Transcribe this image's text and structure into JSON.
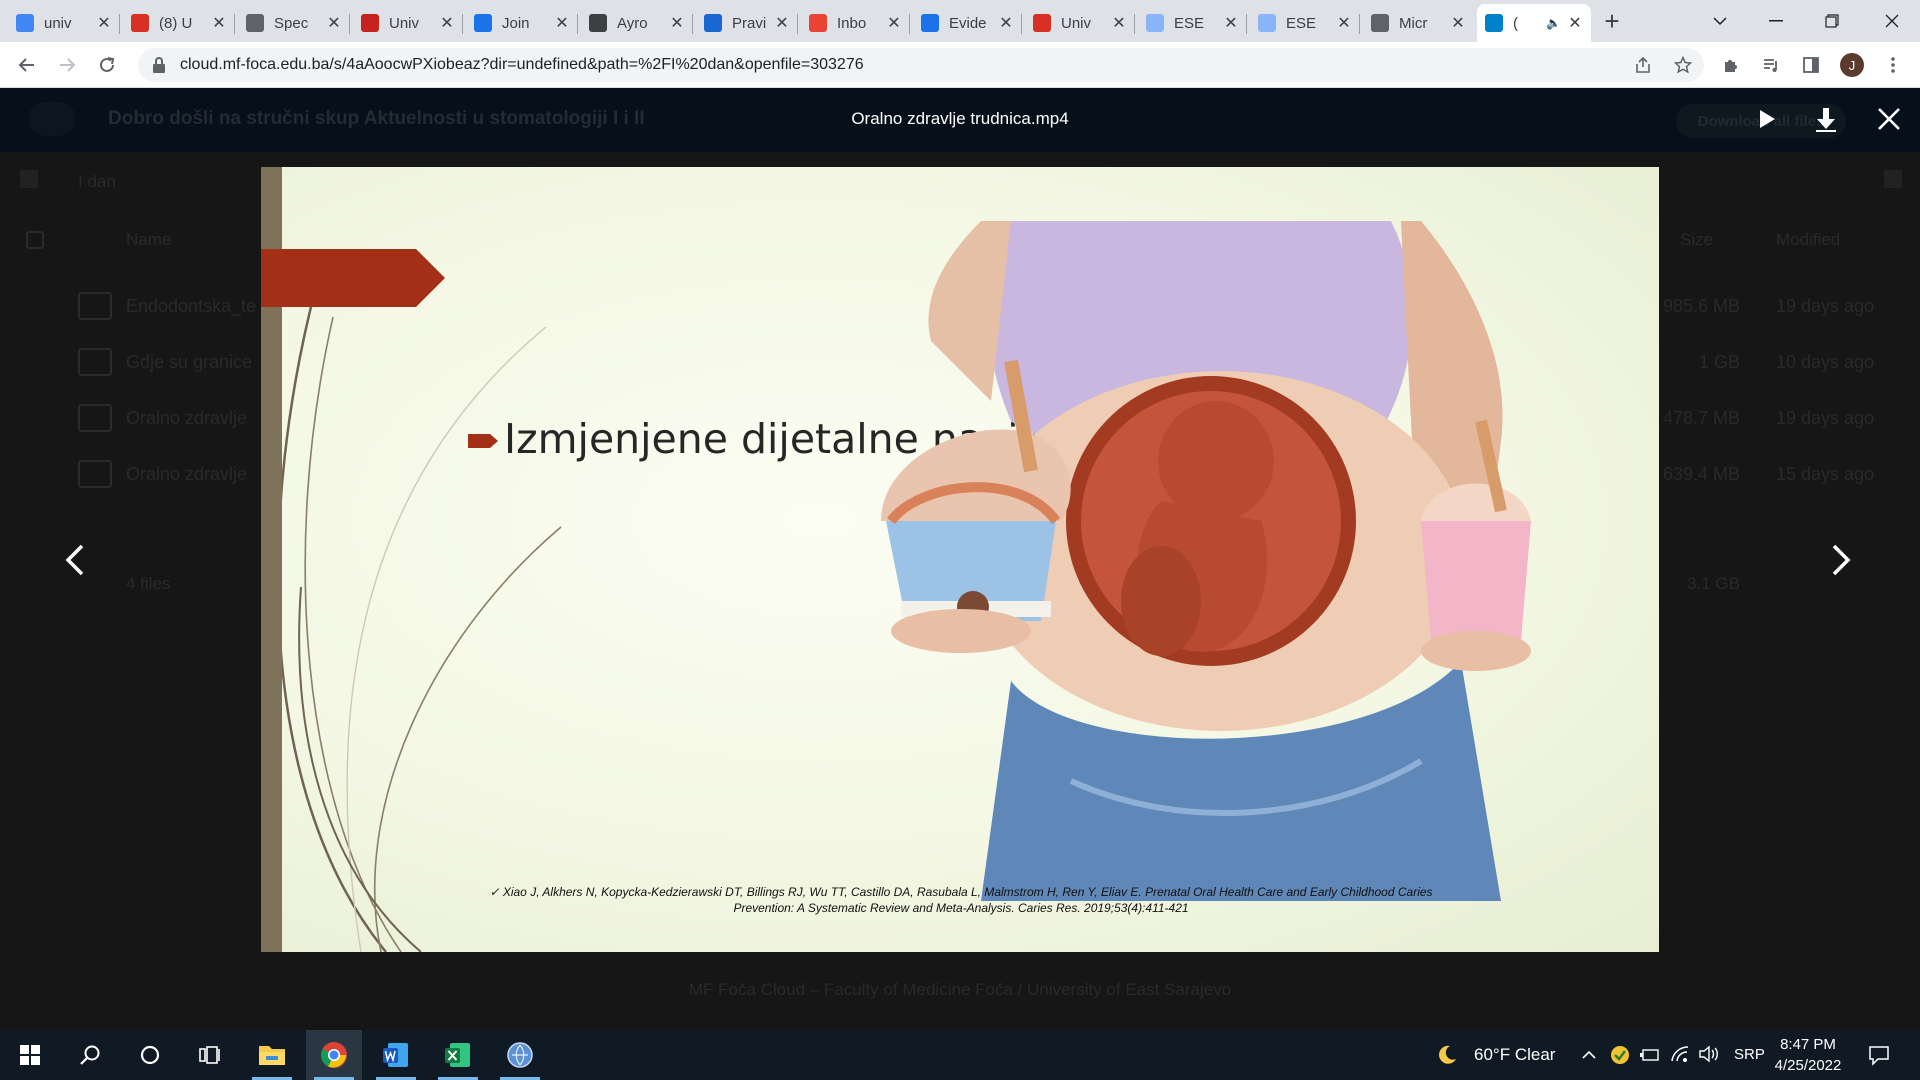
{
  "browser": {
    "tabs": [
      {
        "title": "univ",
        "favicon": "google-icon",
        "color": "#4285f4"
      },
      {
        "title": "(8) U",
        "favicon": "gmail-like-icon",
        "color": "#d93025"
      },
      {
        "title": "Spec",
        "favicon": "globe-icon",
        "color": "#5f6368"
      },
      {
        "title": "Univ",
        "favicon": "shield-crest-icon",
        "color": "#c5221f"
      },
      {
        "title": "Join",
        "favicon": "edge-icon",
        "color": "#1a73e8"
      },
      {
        "title": "Ayro",
        "favicon": "wordpress-icon",
        "color": "#3c4043"
      },
      {
        "title": "Pravi",
        "favicon": "building-icon",
        "color": "#1967d2"
      },
      {
        "title": "Inbo",
        "favicon": "gmail-icon",
        "color": "#ea4335"
      },
      {
        "title": "Evide",
        "favicon": "diamond-icon",
        "color": "#1a73e8"
      },
      {
        "title": "Univ",
        "favicon": "mail-red-icon",
        "color": "#d93025"
      },
      {
        "title": "ESE",
        "favicon": "flag-icon",
        "color": "#8ab4f8"
      },
      {
        "title": "ESE",
        "favicon": "flag-icon",
        "color": "#8ab4f8"
      },
      {
        "title": "Micr",
        "favicon": "globe-icon",
        "color": "#5f6368"
      },
      {
        "title": "(",
        "favicon": "nextcloud-icon",
        "color": "#0082c9"
      }
    ],
    "url": "cloud.mf-foca.edu.ba/s/4aAoocwPXiobeaz?dir=undefined&path=%2FI%20dan&openfile=303276",
    "profile_initial": "J"
  },
  "nextcloud": {
    "share_title": "Dobro došli na stručni skup Aktuelnosti u stomatologiji I i II",
    "download_all": "Download all files",
    "breadcrumb": "I dan",
    "columns": {
      "name": "Name",
      "size": "Size",
      "modified": "Modified"
    },
    "files": [
      {
        "name": "Endodontska_te",
        "size": "985.6 MB",
        "modified": "19 days ago"
      },
      {
        "name": "Gdje su granice",
        "size": "1 GB",
        "modified": "10 days ago"
      },
      {
        "name": "Oralno zdravlje",
        "size": "478.7 MB",
        "modified": "19 days ago"
      },
      {
        "name": "Oralno zdravlje",
        "size": "639.4 MB",
        "modified": "15 days ago"
      }
    ],
    "files_count": "4 files",
    "total_size": "3.1 GB",
    "footer": "MF Foča Cloud – Faculty of Medicine Foča / University of East Sarajevo"
  },
  "viewer": {
    "file_title": "Oralno zdravlje trudnica.mp4",
    "slide": {
      "bullet": "Izmjenjene dijetalne navike",
      "citation_line1": "✓  Xiao J, Alkhers N, Kopycka-Kedzierawski DT, Billings RJ, Wu TT, Castillo DA, Rasubala L, Malmstrom H, Ren Y, Eliav E. Prenatal Oral Health Care and Early Childhood Caries",
      "citation_line2": "Prevention: A Systematic Review and Meta-Analysis. Caries Res. 2019;53(4):411-421"
    },
    "accent_color": "#a33016"
  },
  "taskbar": {
    "weather": "60°F  Clear",
    "language": "SRP",
    "time": "8:47 PM",
    "date": "4/25/2022"
  }
}
